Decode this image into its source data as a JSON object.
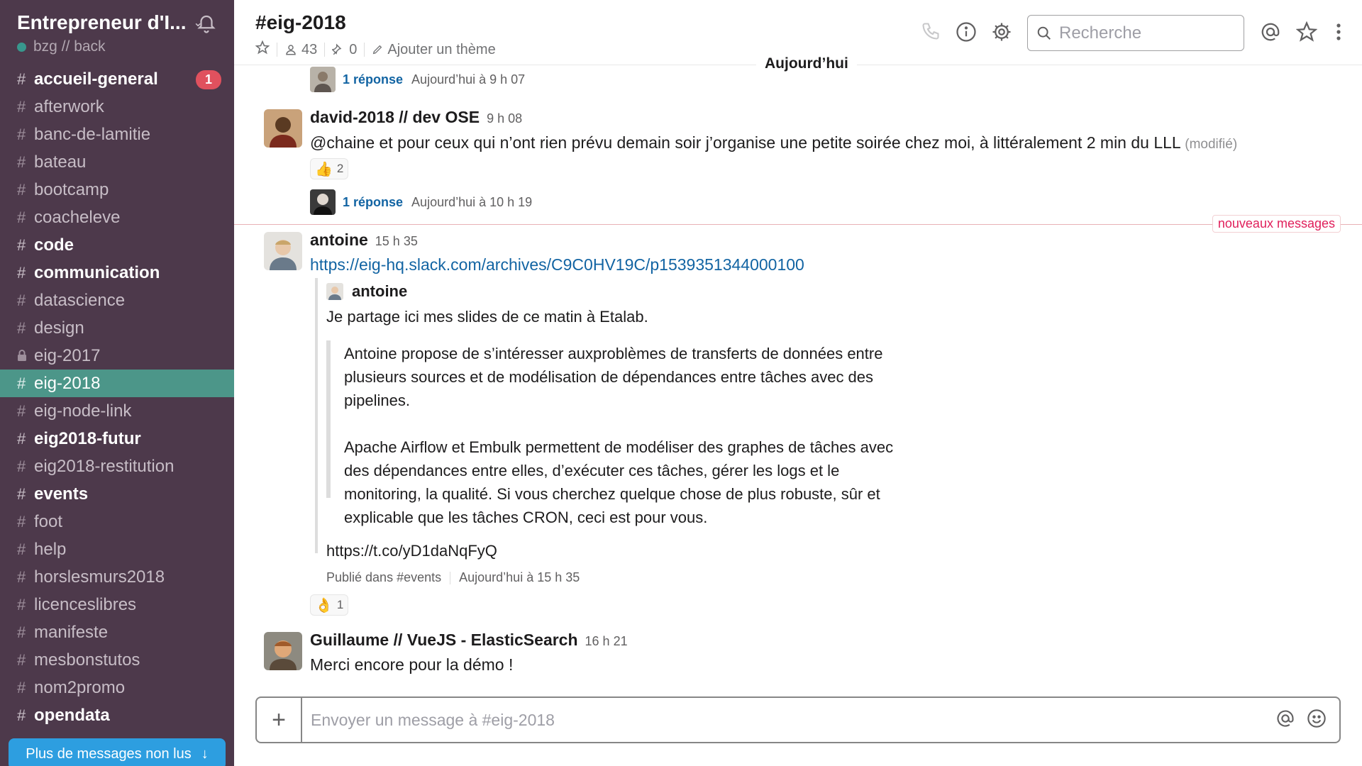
{
  "sidebar": {
    "team_name": "Entrepreneur d'I...",
    "user": "bzg // back",
    "channels": [
      {
        "name": "accueil-general",
        "bold": true,
        "badge": "1"
      },
      {
        "name": "afterwork"
      },
      {
        "name": "banc-de-lamitie"
      },
      {
        "name": "bateau"
      },
      {
        "name": "bootcamp"
      },
      {
        "name": "coacheleve"
      },
      {
        "name": "code",
        "bold": true
      },
      {
        "name": "communication",
        "bold": true
      },
      {
        "name": "datascience"
      },
      {
        "name": "design"
      },
      {
        "name": "eig-2017",
        "private": true
      },
      {
        "name": "eig-2018",
        "active": true
      },
      {
        "name": "eig-node-link"
      },
      {
        "name": "eig2018-futur",
        "bold": true
      },
      {
        "name": "eig2018-restitution"
      },
      {
        "name": "events",
        "bold": true
      },
      {
        "name": "foot"
      },
      {
        "name": "help"
      },
      {
        "name": "horslesmurs2018"
      },
      {
        "name": "licenceslibres"
      },
      {
        "name": "manifeste"
      },
      {
        "name": "mesbonstutos"
      },
      {
        "name": "nom2promo"
      },
      {
        "name": "opendata",
        "bold": true
      }
    ],
    "more_unread": "Plus de messages non lus"
  },
  "header": {
    "title": "#eig-2018",
    "members": "43",
    "pins": "0",
    "topic": "Ajouter un thème",
    "search_placeholder": "Recherche"
  },
  "messages": {
    "day_label": "Aujourd’hui",
    "thread1": {
      "replies": "1 réponse",
      "time": "Aujourd’hui à 9 h 07"
    },
    "msg_david": {
      "author": "david-2018 // dev OSE",
      "time": "9 h 08",
      "text": "@chaine et pour ceux qui n’ont rien prévu demain soir j’organise une petite soirée chez moi, à littéralement 2 min du LLL",
      "edited": "(modifié)",
      "reaction_emoji": "👍",
      "reaction_count": "2",
      "replies": "1 réponse",
      "reply_time": "Aujourd’hui à 10 h 19"
    },
    "new_messages_label": "nouveaux messages",
    "msg_antoine": {
      "author": "antoine",
      "time": "15 h 35",
      "link": "https://eig-hq.slack.com/archives/C9C0HV19C/p1539351344000100",
      "attachment": {
        "author": "antoine",
        "text": "Je partage ici mes slides de ce matin à Etalab.",
        "quote_p1_l1": "Antoine propose de s’intéresser auxproblèmes de transferts de données entre",
        "quote_p1_l2": "plusieurs sources et de modélisation de dépendances entre tâches avec des",
        "quote_p1_l3": "pipelines.",
        "quote_p2_l1": "Apache Airflow et Embulk permettent de modéliser des graphes de tâches avec",
        "quote_p2_l2": "des dépendances entre elles, d’exécuter ces tâches, gérer les logs et le",
        "quote_p2_l3": "monitoring, la qualité.  Si vous cherchez quelque chose de plus robuste, sûr et",
        "quote_p2_l4": "explicable que les tâches CRON, ceci est pour vous.",
        "short_link": "https://t.co/yD1daNqFyQ",
        "footer_channel": "Publié dans #events",
        "footer_time": "Aujourd’hui à 15 h 35"
      },
      "reaction_emoji": "👌",
      "reaction_count": "1"
    },
    "msg_guillaume": {
      "author": "Guillaume // VueJS - ElasticSearch",
      "time": "16 h 21",
      "text": "Merci encore pour la démo !"
    }
  },
  "composer": {
    "placeholder": "Envoyer un message à #eig-2018"
  },
  "colors": {
    "sidebar_bg": "#4d394b",
    "active_channel": "#4c9689",
    "badge": "#e0515e",
    "link": "#1264a3",
    "unread_button": "#2d9ee0",
    "new_messages": "#e01e5a"
  }
}
